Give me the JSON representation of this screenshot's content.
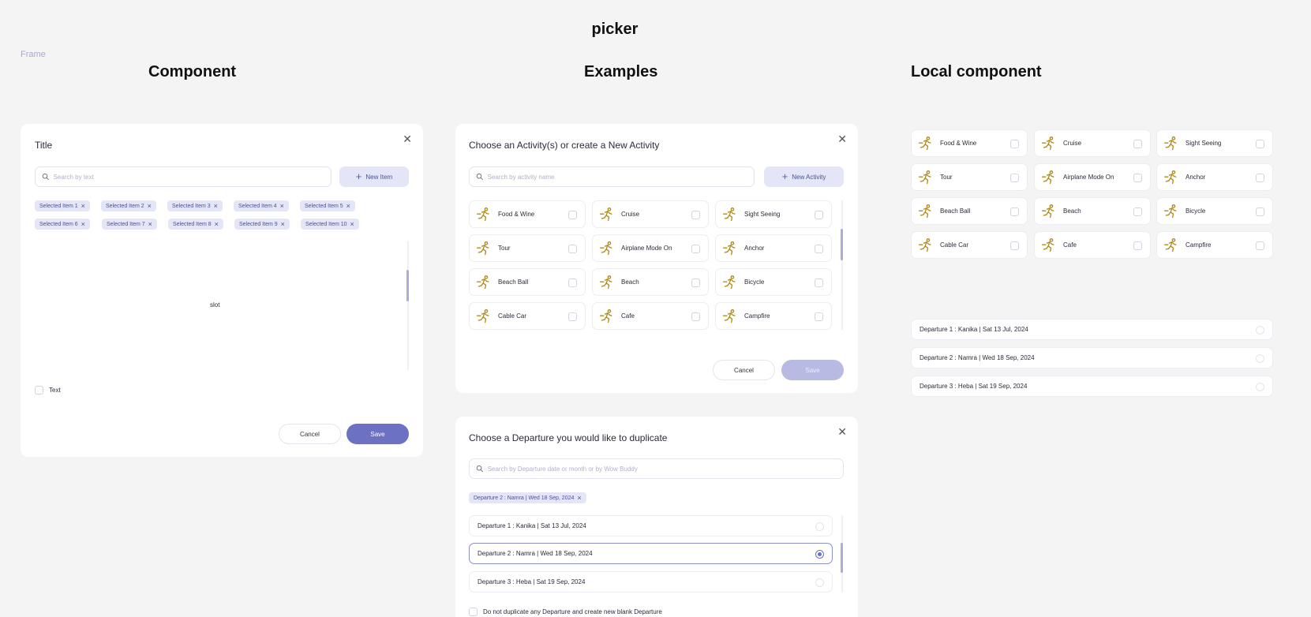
{
  "page": {
    "title": "picker",
    "frame_label": "Frame"
  },
  "sections": {
    "component": "Component",
    "examples": "Examples",
    "local": "Local component"
  },
  "component_dialog": {
    "title": "Title",
    "search_placeholder": "Search by text",
    "new_button": "New Item",
    "chips": [
      "Selected Item 1",
      "Selected Item 2",
      "Selected Item 3",
      "Selected Item 4",
      "Selected Item 5",
      "Selected Item 6",
      "Selected Item 7",
      "Selected Item 8",
      "Selected Item 9",
      "Selected Item 10"
    ],
    "slot_label": "slot",
    "checkbox_label": "Text",
    "cancel": "Cancel",
    "save": "Save"
  },
  "activity_dialog": {
    "title": "Choose an Activity(s) or create a New Activity",
    "search_placeholder": "Search by activity name",
    "new_button": "New Activity",
    "activities": [
      "Food & Wine",
      "Cruise",
      "Sight Seeing",
      "Tour",
      "Airplane Mode On",
      "Anchor",
      "Beach Ball",
      "Beach",
      "Bicycle",
      "Cable Car",
      "Cafe",
      "Campfire"
    ],
    "activity_icon": "running-person-icon",
    "cancel": "Cancel",
    "save": "Save"
  },
  "departure_dialog": {
    "title": "Choose a Departure you would like to duplicate",
    "search_placeholder": "Search by Departure date or month or by Wow Buddy",
    "chip": "Departure 2 : Namra | Wed 18 Sep, 2024",
    "departures": [
      "Departure 1 : Kanika | Sat 13 Jul, 2024",
      "Departure 2 : Namra | Wed 18 Sep, 2024",
      "Departure 3 : Heba | Sat 19 Sep, 2024"
    ],
    "selected_index": 1,
    "blank_option": "Do not duplicate any Departure and create new blank Departure"
  },
  "local_component": {
    "tiles": [
      "Food & Wine",
      "Cruise",
      "Sight Seeing",
      "Tour",
      "Airplane Mode On",
      "Anchor",
      "Beach Ball",
      "Beach",
      "Bicycle",
      "Cable Car",
      "Cafe",
      "Campfire"
    ],
    "departures": [
      "Departure 1 : Kanika | Sat 13 Jul, 2024",
      "Departure 2 : Namra | Wed 18 Sep, 2024",
      "Departure 3 : Heba | Sat 19 Sep, 2024"
    ]
  },
  "colors": {
    "accent": "#6c71c4",
    "chip_bg": "#e4e6f8",
    "icon": "#b08a1e",
    "background": "#f4f4f5"
  }
}
